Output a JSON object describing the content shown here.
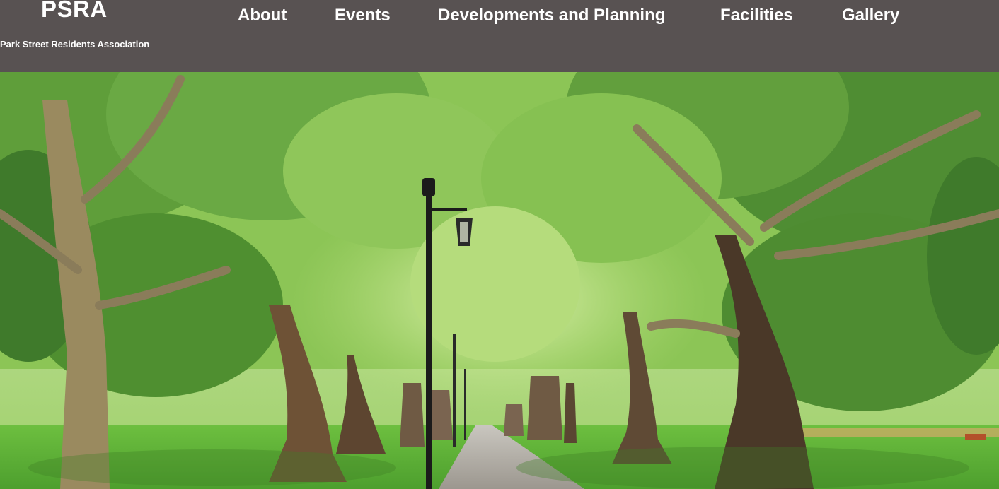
{
  "site": {
    "title": "PSRA",
    "subtitle": "Park Street Residents Association"
  },
  "nav": {
    "items": [
      {
        "label": "About"
      },
      {
        "label": "Events"
      },
      {
        "label": "Developments and Planning"
      },
      {
        "label": "Facilities"
      },
      {
        "label": "Gallery"
      }
    ]
  },
  "hero": {
    "icon": "park-avenue-photo",
    "colors": {
      "header_bg": "#585252",
      "foliage_light": "#a6d65c",
      "foliage_dark": "#3f7a2b",
      "grass": "#5fb33b",
      "trunk": "#5a4632",
      "path": "#a8a39c"
    }
  }
}
